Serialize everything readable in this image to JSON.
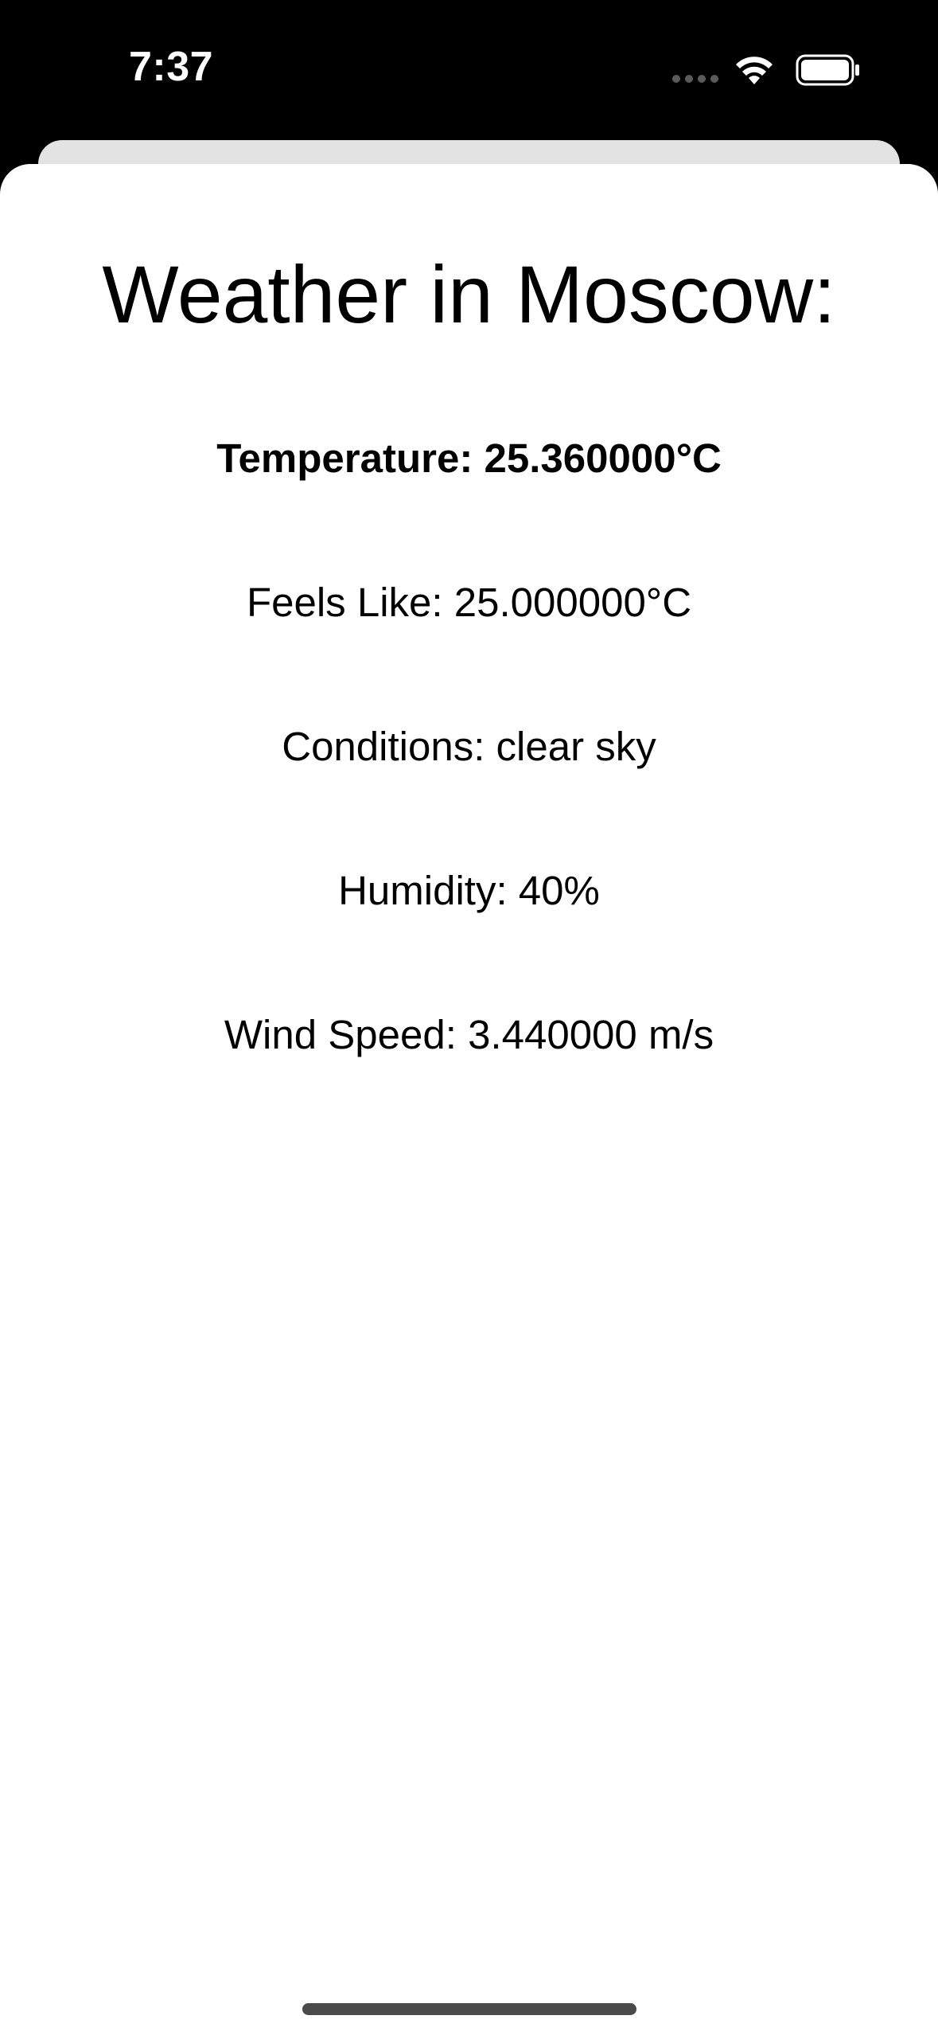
{
  "status_bar": {
    "time": "7:37",
    "wifi_icon": "wifi-icon",
    "battery_icon": "battery-icon",
    "signal_icon": "cellular-dots-icon"
  },
  "weather": {
    "title": "Weather in Moscow:",
    "temperature": "Temperature: 25.360000°C",
    "feels_like": "Feels Like: 25.000000°C",
    "conditions": "Conditions: clear sky",
    "humidity": "Humidity: 40%",
    "wind_speed": "Wind Speed: 3.440000 m/s"
  },
  "colors": {
    "background": "#000000",
    "sheet": "#ffffff",
    "back_sheet": "#e3e3e3",
    "text": "#000000"
  }
}
